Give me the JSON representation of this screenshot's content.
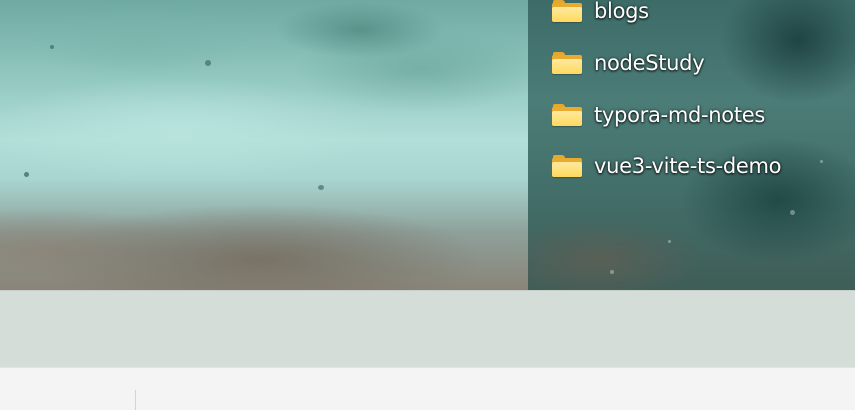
{
  "desktop": {
    "icons": [
      {
        "label": "blogs",
        "icon": "folder-icon"
      },
      {
        "label": "nodeStudy",
        "icon": "folder-icon"
      },
      {
        "label": "typora-md-notes",
        "icon": "folder-icon"
      },
      {
        "label": "vue3-vite-ts-demo",
        "icon": "folder-icon"
      }
    ]
  },
  "colors": {
    "folder_front": "#ffd95c",
    "folder_back": "#e8ab2f",
    "taskbar": "#d5ddd8",
    "window_background": "#f3f4f3"
  }
}
